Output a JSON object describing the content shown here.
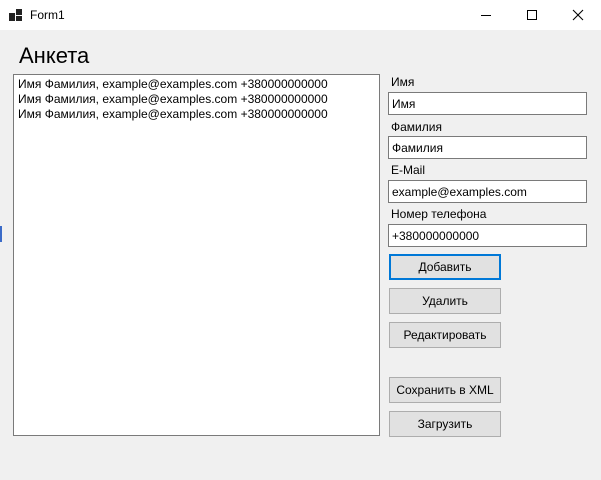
{
  "window": {
    "title": "Form1",
    "icons": {
      "app": "app-icon",
      "minimize": "minimize-icon",
      "maximize": "maximize-icon",
      "close": "close-icon"
    }
  },
  "form": {
    "heading": "Анкета",
    "records": [
      "Имя Фамилия, example@examples.com +380000000000",
      "Имя Фамилия, example@examples.com +380000000000",
      "Имя Фамилия, example@examples.com +380000000000"
    ],
    "fields": {
      "first_name": {
        "label": "Имя",
        "value": "Имя"
      },
      "last_name": {
        "label": "Фамилия",
        "value": "Фамилия"
      },
      "email": {
        "label": "E-Mail",
        "value": "example@examples.com"
      },
      "phone": {
        "label": "Номер телефона",
        "value": "+380000000000"
      }
    },
    "buttons": {
      "add": "Добавить",
      "delete": "Удалить",
      "edit": "Редактировать",
      "save_xml": "Сохранить в XML",
      "load": "Загрузить"
    },
    "colors": {
      "focus_border": "#0078d7",
      "button_bg": "#e1e1e1",
      "window_bg": "#f0f0f0"
    }
  }
}
